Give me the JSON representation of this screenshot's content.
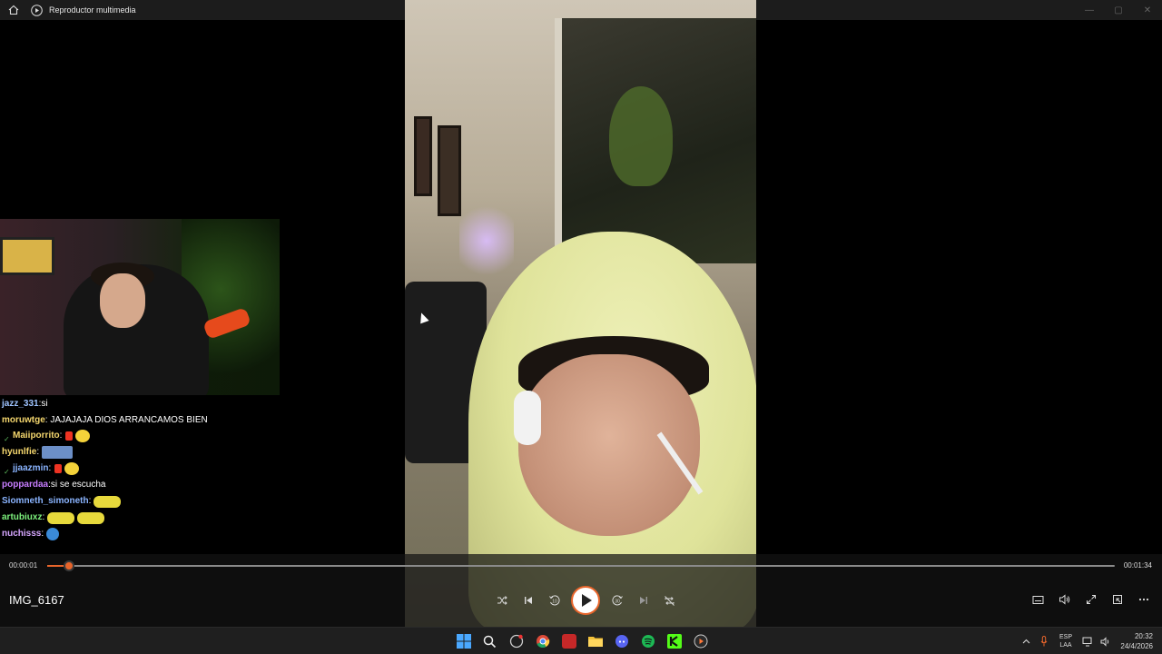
{
  "titlebar": {
    "title": "Reproductor multimedia"
  },
  "chat": {
    "messages": [
      {
        "user": "jazz_331",
        "user_color": "#9ec3ff",
        "text": "si",
        "badge": false,
        "emotes": []
      },
      {
        "user": "moruwtge",
        "user_color": "#f5d76e",
        "text": "JAJAJAJA DIOS ARRANCAMOS BIEN",
        "badge": false,
        "emotes": []
      },
      {
        "user": "Maiiporrito",
        "user_color": "#f5d76e",
        "text": "",
        "badge": true,
        "emotes": [
          "red",
          "yellow"
        ]
      },
      {
        "user": "hyunlfie",
        "user_color": "#f5d76e",
        "text": "",
        "badge": false,
        "emotes": [
          "box"
        ]
      },
      {
        "user": "jjaazmin",
        "user_color": "#8ab4ff",
        "text": "",
        "badge": true,
        "emotes": [
          "red",
          "yellow"
        ]
      },
      {
        "user": "poppardaa",
        "user_color": "#c77dff",
        "text": "si se escucha",
        "badge": false,
        "emotes": []
      },
      {
        "user": "Siomneth_simoneth",
        "user_color": "#8ab4ff",
        "text": "",
        "badge": false,
        "emotes": [
          "wide"
        ]
      },
      {
        "user": "artubiuxz",
        "user_color": "#7cf07c",
        "text": "",
        "badge": false,
        "emotes": [
          "wide",
          "wide"
        ]
      },
      {
        "user": "nuchisss",
        "user_color": "#d6a7ff",
        "text": "",
        "badge": false,
        "emotes": [
          "globe"
        ]
      }
    ]
  },
  "player": {
    "current_time": "00:00:01",
    "duration": "00:01:34",
    "progress_fraction": 0.02,
    "filename": "IMG_6167",
    "accent_color": "#e8652b"
  },
  "taskbar": {
    "language": "ESP",
    "layout": "LAA",
    "time": "20:32",
    "date": "24/4/2026",
    "icons": [
      "windows-start-icon",
      "search-icon",
      "pinned-app-icon",
      "chrome-icon",
      "media-app-icon",
      "file-explorer-icon",
      "discord-icon",
      "spotify-icon",
      "kick-icon",
      "media-player-icon"
    ]
  }
}
